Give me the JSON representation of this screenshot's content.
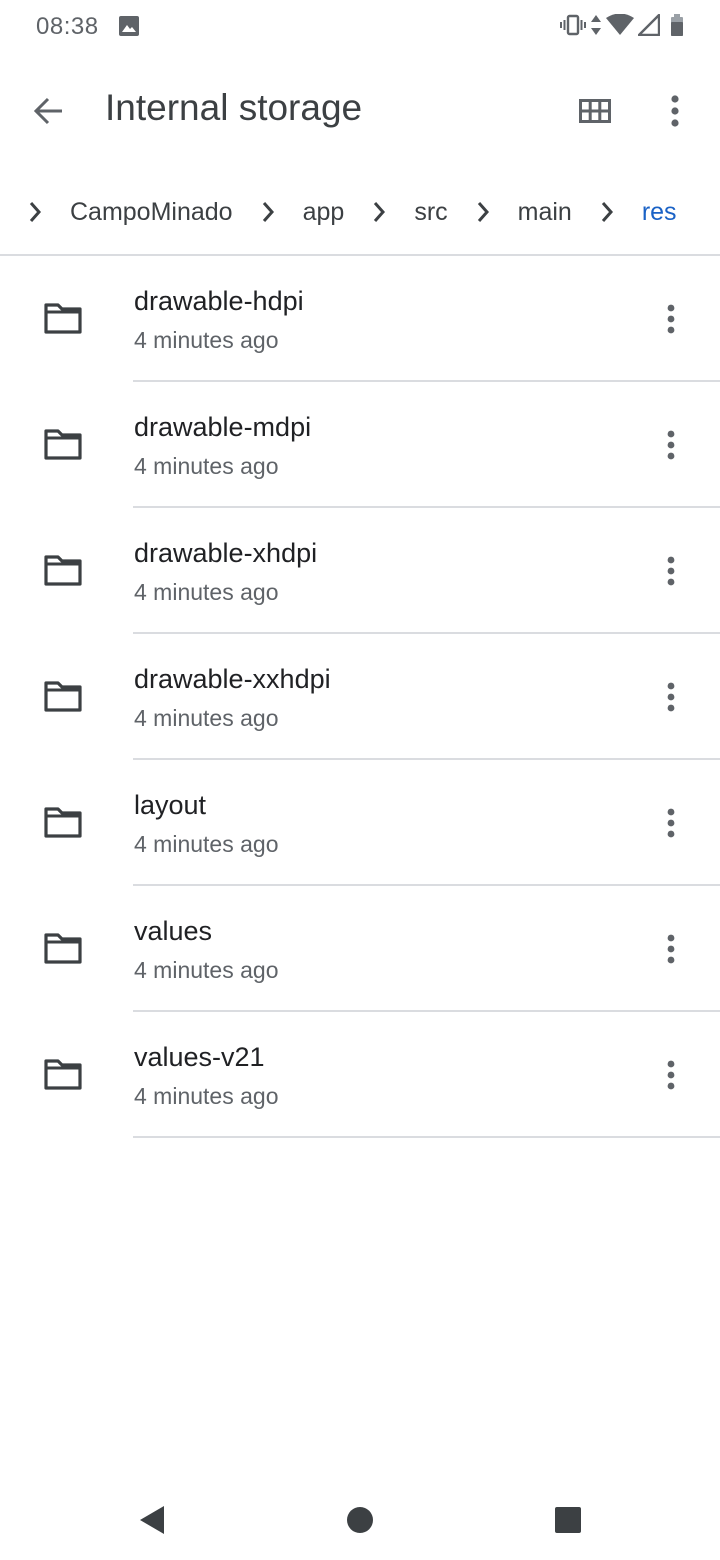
{
  "status_bar": {
    "time": "08:38",
    "icons": [
      "image-icon",
      "vibrate-icon",
      "data-arrows-icon",
      "wifi-icon",
      "signal-icon",
      "battery-icon"
    ]
  },
  "toolbar": {
    "title": "Internal storage",
    "icons": {
      "back": "arrow-back-icon",
      "grid": "grid-view-icon",
      "more": "more-vert-icon"
    }
  },
  "breadcrumb": {
    "items": [
      "CampoMinado",
      "app",
      "src",
      "main",
      "res"
    ],
    "active_color": "#1a62c6"
  },
  "files": [
    {
      "name": "drawable-hdpi",
      "meta": "4 minutes ago"
    },
    {
      "name": "drawable-mdpi",
      "meta": "4 minutes ago"
    },
    {
      "name": "drawable-xhdpi",
      "meta": "4 minutes ago"
    },
    {
      "name": "drawable-xxhdpi",
      "meta": "4 minutes ago"
    },
    {
      "name": "layout",
      "meta": "4 minutes ago"
    },
    {
      "name": "values",
      "meta": "4 minutes ago"
    },
    {
      "name": "values-v21",
      "meta": "4 minutes ago"
    }
  ],
  "nav_bar": {
    "icons": [
      "nav-back-icon",
      "nav-home-icon",
      "nav-recents-icon"
    ]
  }
}
